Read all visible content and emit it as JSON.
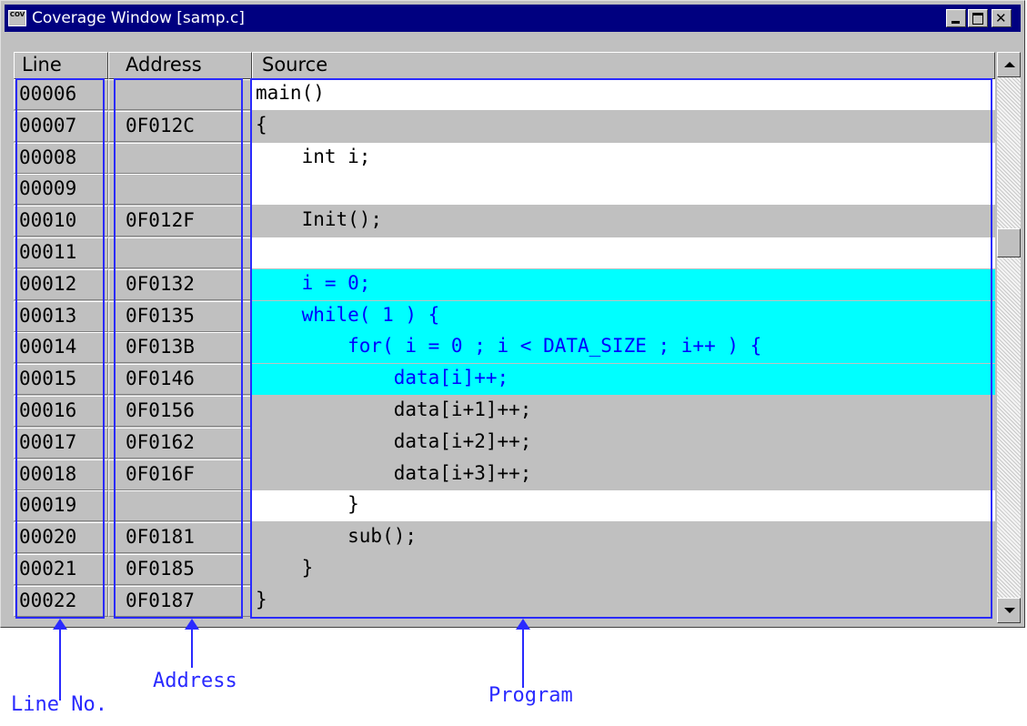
{
  "window": {
    "title": "Coverage Window [samp.c]",
    "icon_text": "COV",
    "controls": [
      "minimize",
      "maximize",
      "close"
    ]
  },
  "columns": {
    "line": "Line",
    "address": "Address",
    "source": "Source"
  },
  "colors": {
    "executed": "#c0c0c0",
    "not_executable": "#ffffff",
    "selected": "#00ffff",
    "selected_text": "#0000ff",
    "annotation": "#2a2aff"
  },
  "rows": [
    {
      "line": "00006",
      "address": "",
      "source": "main()",
      "state": "none"
    },
    {
      "line": "00007",
      "address": "0F012C",
      "source": "{",
      "state": "exec"
    },
    {
      "line": "00008",
      "address": "",
      "source": "    int i;",
      "state": "none"
    },
    {
      "line": "00009",
      "address": "",
      "source": "",
      "state": "none"
    },
    {
      "line": "00010",
      "address": "0F012F",
      "source": "    Init();",
      "state": "exec"
    },
    {
      "line": "00011",
      "address": "",
      "source": "",
      "state": "none"
    },
    {
      "line": "00012",
      "address": "0F0132",
      "source": "    i = 0;",
      "state": "sel"
    },
    {
      "line": "00013",
      "address": "0F0135",
      "source": "    while( 1 ) {",
      "state": "sel"
    },
    {
      "line": "00014",
      "address": "0F013B",
      "source": "        for( i = 0 ; i < DATA_SIZE ; i++ ) {",
      "state": "sel"
    },
    {
      "line": "00015",
      "address": "0F0146",
      "source": "            data[i]++;",
      "state": "sel"
    },
    {
      "line": "00016",
      "address": "0F0156",
      "source": "            data[i+1]++;",
      "state": "exec"
    },
    {
      "line": "00017",
      "address": "0F0162",
      "source": "            data[i+2]++;",
      "state": "exec"
    },
    {
      "line": "00018",
      "address": "0F016F",
      "source": "            data[i+3]++;",
      "state": "exec"
    },
    {
      "line": "00019",
      "address": "",
      "source": "        }",
      "state": "none"
    },
    {
      "line": "00020",
      "address": "0F0181",
      "source": "        sub();",
      "state": "exec"
    },
    {
      "line": "00021",
      "address": "0F0185",
      "source": "    }",
      "state": "exec"
    },
    {
      "line": "00022",
      "address": "0F0187",
      "source": "}",
      "state": "exec"
    }
  ],
  "annotations": {
    "line_no": "Line No.",
    "address": "Address",
    "program": "Program"
  }
}
